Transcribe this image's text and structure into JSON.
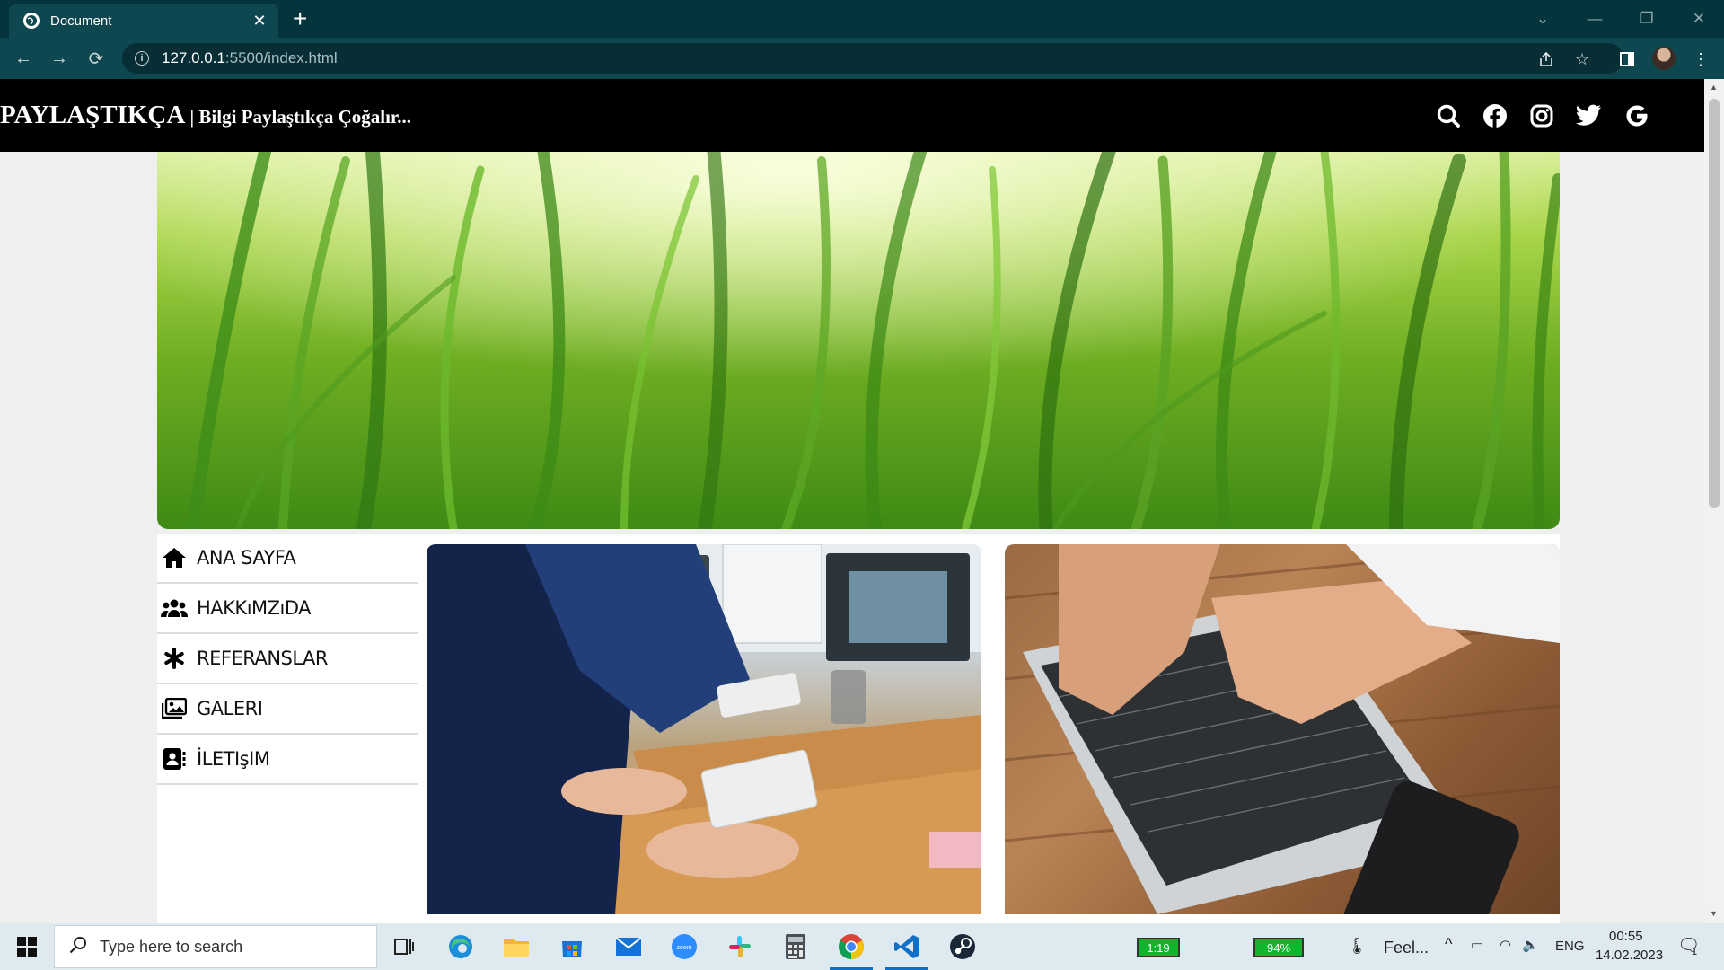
{
  "browser": {
    "tab_title": "Document",
    "url_host": "127.0.0.1",
    "url_path": ":5500/index.html"
  },
  "site": {
    "brand_name": "PAYLAŞTIKÇA",
    "tagline": " | Bilgi Paylaştıkça Çoğalır...",
    "social_icons": [
      "search-icon",
      "facebook-icon",
      "instagram-icon",
      "twitter-icon",
      "google-icon"
    ],
    "nav": [
      {
        "label": "ANA SAYFA",
        "icon": "home-icon"
      },
      {
        "label": "HAKKıMZıDA",
        "icon": "users-icon"
      },
      {
        "label": "REFERANSLAR",
        "icon": "asterisk-icon"
      },
      {
        "label": "GALERI",
        "icon": "gallery-icon"
      },
      {
        "label": "İLETIşIM",
        "icon": "contact-icon"
      }
    ]
  },
  "taskbar": {
    "search_placeholder": "Type here to search",
    "battery_timer": "1:19",
    "battery_percent": "94%",
    "weather_text": "Feel...",
    "language": "ENG",
    "time": "00:55",
    "date": "14.02.2023",
    "notification_count": "1"
  },
  "colors": {
    "header_bg": "#000000",
    "browser_frame": "#04353d",
    "taskbar_bg": "#dfe9f0",
    "vscode_blue": "#0f6fc6"
  }
}
